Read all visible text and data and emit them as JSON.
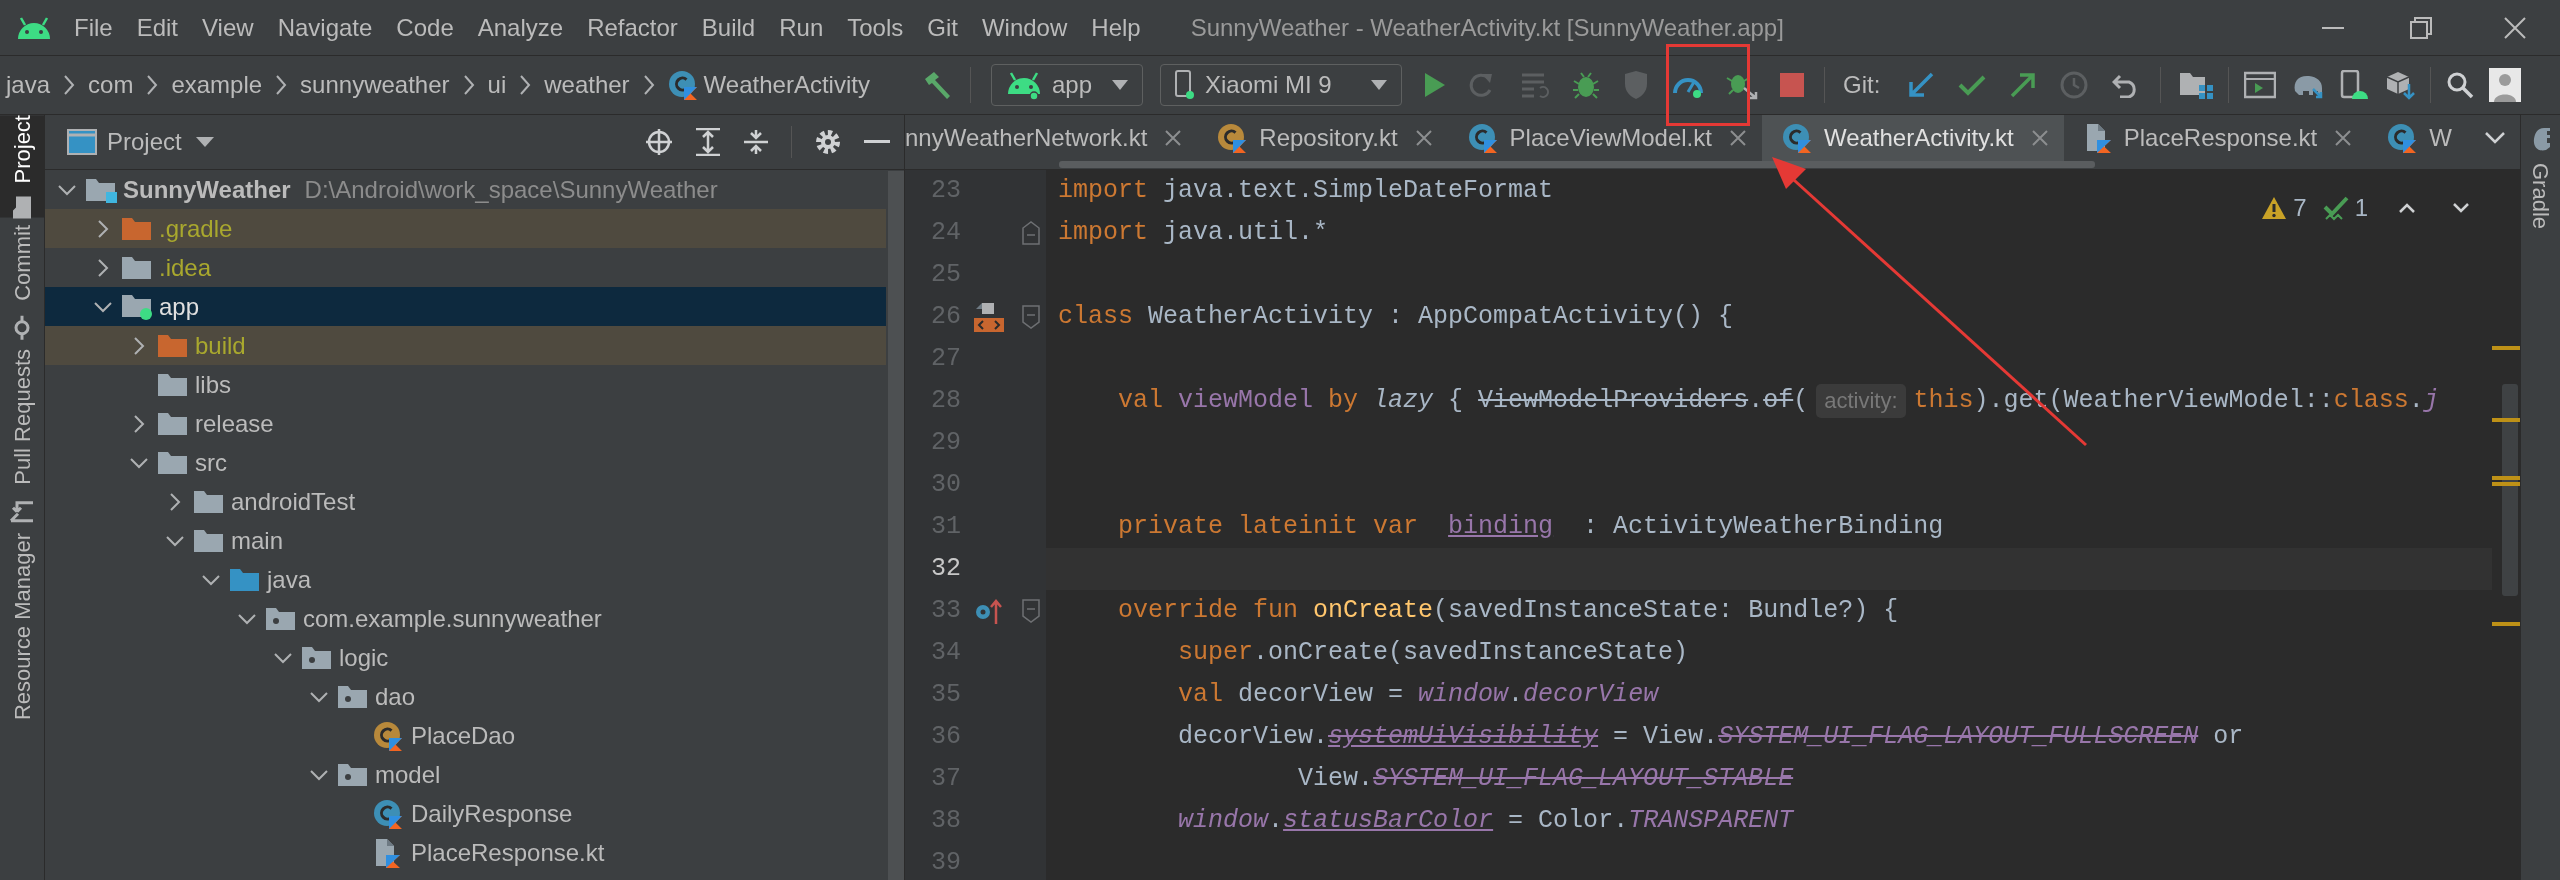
{
  "window": {
    "title": "SunnyWeather - WeatherActivity.kt [SunnyWeather.app]"
  },
  "menu": [
    "File",
    "Edit",
    "View",
    "Navigate",
    "Code",
    "Analyze",
    "Refactor",
    "Build",
    "Run",
    "Tools",
    "Git",
    "Window",
    "Help"
  ],
  "breadcrumb": [
    {
      "label": "java",
      "kind": "package"
    },
    {
      "label": "com",
      "kind": "package"
    },
    {
      "label": "example",
      "kind": "package"
    },
    {
      "label": "sunnyweather",
      "kind": "package"
    },
    {
      "label": "ui",
      "kind": "package"
    },
    {
      "label": "weather",
      "kind": "package"
    },
    {
      "label": "WeatherActivity",
      "kind": "class"
    }
  ],
  "toolbar": {
    "run_config": "app",
    "device": "Xiaomi MI 9",
    "git_label": "Git:"
  },
  "tool_strip": [
    {
      "label": "Project",
      "selected": true
    },
    {
      "label": "Commit",
      "selected": false
    },
    {
      "label": "Pull Requests",
      "selected": false
    },
    {
      "label": "Resource Manager",
      "selected": false
    }
  ],
  "project_panel": {
    "title": "Project",
    "tree": [
      {
        "label": "SunnyWeather",
        "path": "D:\\Android\\work_space\\SunnyWeather",
        "kind": "module",
        "expanded": true,
        "selected": false,
        "children": [
          {
            "label": ".gradle",
            "kind": "excluded",
            "expanded": false,
            "selected": false
          },
          {
            "label": ".idea",
            "kind": "ignored",
            "expanded": false,
            "selected": false
          },
          {
            "label": "app",
            "kind": "android-module",
            "expanded": true,
            "selected": true,
            "children": [
              {
                "label": "build",
                "kind": "excluded",
                "expanded": false,
                "selected": false
              },
              {
                "label": "libs",
                "kind": "folder",
                "selected": false
              },
              {
                "label": "release",
                "kind": "folder",
                "expanded": false,
                "selected": false
              },
              {
                "label": "src",
                "kind": "folder",
                "expanded": true,
                "selected": false,
                "children": [
                  {
                    "label": "androidTest",
                    "kind": "folder",
                    "expanded": false,
                    "selected": false
                  },
                  {
                    "label": "main",
                    "kind": "folder",
                    "expanded": true,
                    "selected": false,
                    "children": [
                      {
                        "label": "java",
                        "kind": "source",
                        "expanded": true,
                        "selected": false,
                        "children": [
                          {
                            "label": "com.example.sunnyweather",
                            "kind": "package",
                            "expanded": true,
                            "selected": false,
                            "children": [
                              {
                                "label": "logic",
                                "kind": "package",
                                "expanded": true,
                                "selected": false,
                                "children": [
                                  {
                                    "label": "dao",
                                    "kind": "package",
                                    "expanded": true,
                                    "selected": false,
                                    "children": [
                                      {
                                        "label": "PlaceDao",
                                        "kind": "object",
                                        "selected": false
                                      }
                                    ]
                                  },
                                  {
                                    "label": "model",
                                    "kind": "package",
                                    "expanded": true,
                                    "selected": false,
                                    "children": [
                                      {
                                        "label": "DailyResponse",
                                        "kind": "class",
                                        "selected": false
                                      },
                                      {
                                        "label": "PlaceResponse.kt",
                                        "kind": "kotlin-file",
                                        "selected": false
                                      }
                                    ]
                                  }
                                ]
                              }
                            ]
                          }
                        ]
                      }
                    ]
                  }
                ]
              }
            ]
          }
        ]
      }
    ]
  },
  "tabs": [
    {
      "label": "nnyWeatherNetwork.kt",
      "kind": "none",
      "selected": false,
      "closable": true
    },
    {
      "label": "Repository.kt",
      "kind": "object",
      "selected": false,
      "closable": true
    },
    {
      "label": "PlaceViewModel.kt",
      "kind": "class",
      "selected": false,
      "closable": true
    },
    {
      "label": "WeatherActivity.kt",
      "kind": "class",
      "selected": true,
      "closable": true
    },
    {
      "label": "PlaceResponse.kt",
      "kind": "kotlin-file",
      "selected": false,
      "closable": true
    },
    {
      "label": "W",
      "kind": "class",
      "selected": false,
      "closable": false
    }
  ],
  "editor": {
    "inspections": {
      "warnings": "7",
      "weak_warnings": "1"
    },
    "lines": [
      {
        "number": "23",
        "current": false,
        "tokens": [
          {
            "text": "import",
            "kind": "kw"
          },
          {
            "text": " java.text.SimpleDateFormat",
            "kind": "plain"
          }
        ]
      },
      {
        "number": "24",
        "current": false,
        "fold": {
          "kind": "end"
        },
        "tokens": [
          {
            "text": "import",
            "kind": "kw"
          },
          {
            "text": " java.util.*",
            "kind": "plain"
          }
        ]
      },
      {
        "number": "25",
        "current": false
      },
      {
        "number": "26",
        "current": false,
        "fold": {
          "kind": "start"
        },
        "gutter": {
          "kind": "layout"
        },
        "tokens": [
          {
            "text": "class",
            "kind": "kw"
          },
          {
            "text": " WeatherActivity : AppCompatActivity() {",
            "kind": "plain"
          }
        ]
      },
      {
        "number": "27",
        "current": false
      },
      {
        "number": "28",
        "current": false,
        "tokens": [
          {
            "text": "    val",
            "kind": "kw"
          },
          {
            "text": " viewModel",
            "kind": "prop"
          },
          {
            "text": " by",
            "kind": "kw"
          },
          {
            "text": " lazy",
            "kind": "italic"
          },
          {
            "text": " { ",
            "kind": "plain"
          },
          {
            "text": "ViewModelProviders",
            "kind": "deprecated"
          },
          {
            "text": ".",
            "kind": "plain"
          },
          {
            "text": "of",
            "kind": "deprecated"
          },
          {
            "text": "(",
            "kind": "plain"
          },
          {
            "text": "activity:",
            "kind": "hint"
          },
          {
            "text": "this",
            "kind": "kw"
          },
          {
            "text": ").get(WeatherViewModel::",
            "kind": "plain"
          },
          {
            "text": "class",
            "kind": "kw"
          },
          {
            "text": ".",
            "kind": "plain"
          },
          {
            "text": "j",
            "kind": "ext"
          }
        ]
      },
      {
        "number": "29",
        "current": false
      },
      {
        "number": "30",
        "current": false
      },
      {
        "number": "31",
        "current": false,
        "tokens": [
          {
            "text": "    private lateinit var  ",
            "kind": "kw"
          },
          {
            "text": "binding",
            "kind": "field"
          },
          {
            "text": "  : ActivityWeatherBinding",
            "kind": "plain"
          }
        ]
      },
      {
        "number": "32",
        "current": true
      },
      {
        "number": "33",
        "current": false,
        "fold": {
          "kind": "start"
        },
        "gutter": {
          "kind": "override"
        },
        "tokens": [
          {
            "text": "    override fun",
            "kind": "kw"
          },
          {
            "text": " onCreate",
            "kind": "fn"
          },
          {
            "text": "(savedInstanceState: Bundle?) {",
            "kind": "plain"
          }
        ]
      },
      {
        "number": "34",
        "current": false,
        "tokens": [
          {
            "text": "        super",
            "kind": "kw"
          },
          {
            "text": ".onCreate(savedInstanceState)",
            "kind": "plain"
          }
        ]
      },
      {
        "number": "35",
        "current": false,
        "tokens": [
          {
            "text": "        val",
            "kind": "kw"
          },
          {
            "text": " decorView = ",
            "kind": "plain"
          },
          {
            "text": "window",
            "kind": "ext"
          },
          {
            "text": ".",
            "kind": "plain"
          },
          {
            "text": "decorView",
            "kind": "ext"
          }
        ]
      },
      {
        "number": "36",
        "current": false,
        "tokens": [
          {
            "text": "        decorView.",
            "kind": "plain"
          },
          {
            "text": "systemUiVisibility",
            "kind": "ext-deprecated-underline"
          },
          {
            "text": " = View.",
            "kind": "plain"
          },
          {
            "text": "SYSTEM_UI_FLAG_LAYOUT_FULLSCREEN",
            "kind": "ext-deprecated"
          },
          {
            "text": " or",
            "kind": "plain"
          }
        ]
      },
      {
        "number": "37",
        "current": false,
        "tokens": [
          {
            "text": "                View.",
            "kind": "plain"
          },
          {
            "text": "SYSTEM_UI_FLAG_LAYOUT_STABLE",
            "kind": "ext-deprecated"
          }
        ]
      },
      {
        "number": "38",
        "current": false,
        "tokens": [
          {
            "text": "        window",
            "kind": "ext"
          },
          {
            "text": ".",
            "kind": "plain"
          },
          {
            "text": "statusBarColor",
            "kind": "ext-underline"
          },
          {
            "text": " = Color.",
            "kind": "plain"
          },
          {
            "text": "TRANSPARENT",
            "kind": "ext"
          }
        ]
      },
      {
        "number": "39",
        "current": false
      }
    ]
  },
  "right_strip": [
    {
      "label": "Gradle",
      "selected": false
    }
  ]
}
